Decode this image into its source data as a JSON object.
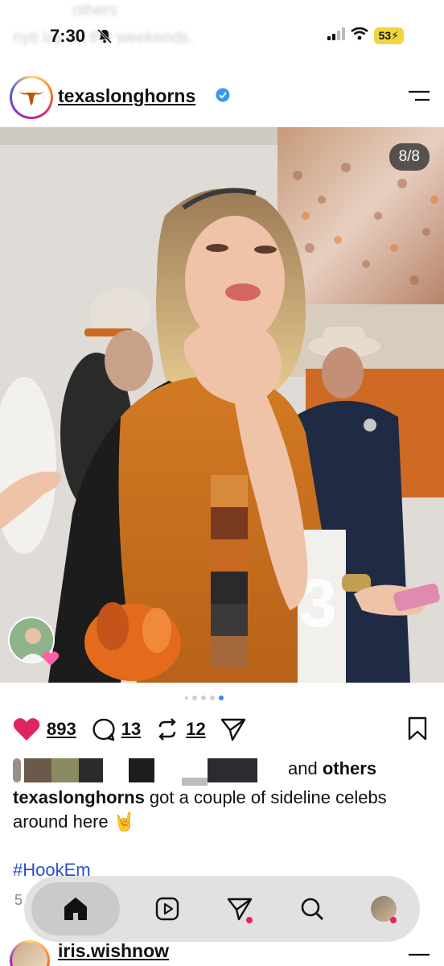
{
  "status_bar": {
    "ghost_line_1": "others",
    "ghost_line_2": "nyti         lay on the weekends.",
    "time": "7:30",
    "battery": "53"
  },
  "post": {
    "username": "texaslonghorns",
    "carousel_counter": "8/8",
    "likes_count": "893",
    "comments_count": "13",
    "reposts_count": "12",
    "liked_by_suffix": " and ",
    "liked_by_others": "others",
    "caption_user": "texaslonghorns",
    "caption_text": " got a couple of sideline celebs around here 🤘",
    "hashtag": "#HookEm",
    "peek_digit": "5",
    "carousel_total": 8,
    "carousel_index": 8
  },
  "next_post": {
    "username": "iris.wishnow"
  },
  "nav": {
    "items": [
      "home",
      "reels",
      "messages",
      "search",
      "profile"
    ]
  },
  "colors": {
    "like_red": "#e0245e",
    "link_blue": "#2b4fd1",
    "verified_blue": "#3897f0"
  }
}
